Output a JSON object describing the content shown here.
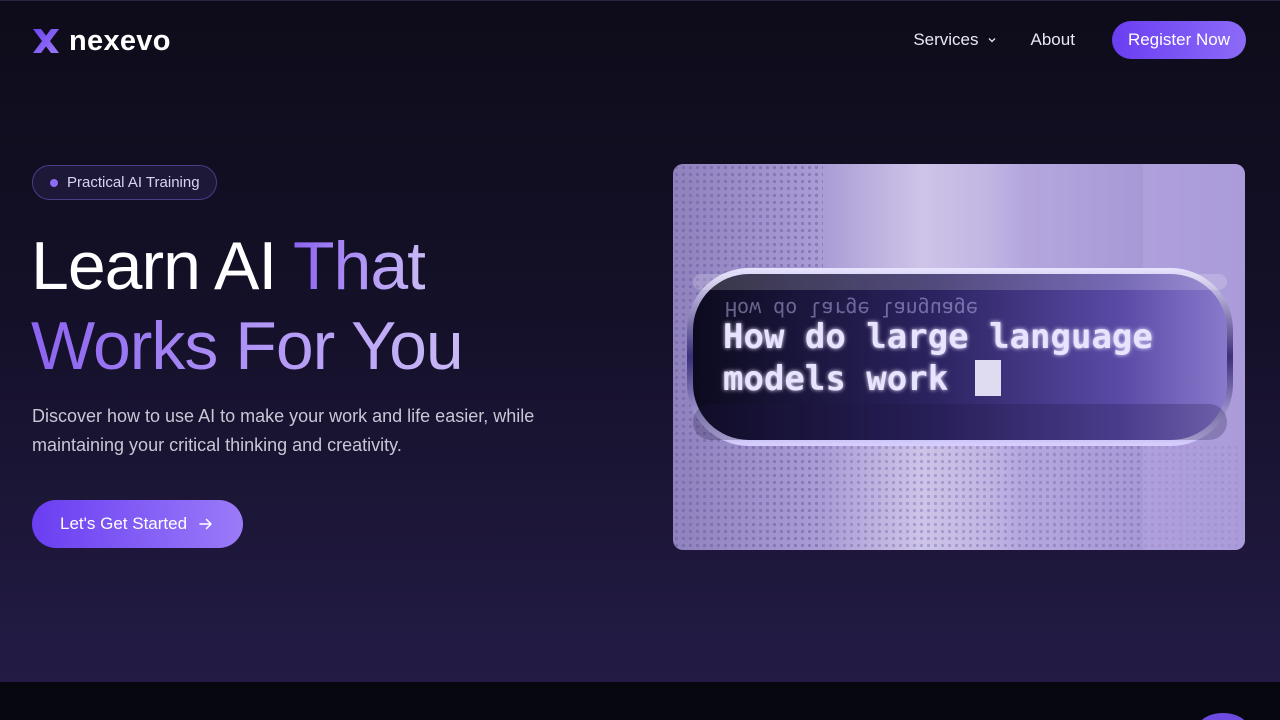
{
  "brand": {
    "name": "nexevo",
    "accent": "#7a4ff0"
  },
  "nav": {
    "services_label": "Services",
    "about_label": "About",
    "register_label": "Register Now"
  },
  "hero": {
    "badge": "Practical AI Training",
    "headline_line1_white": "Learn AI ",
    "headline_line1_accent": "That",
    "headline_line2_accent": "Works For You",
    "subtitle": "Discover how to use AI to make your work and life easier, while maintaining your critical thinking and creativity.",
    "cta_label": "Let's Get Started",
    "cta_icon": "arrow-right-icon"
  },
  "hero_image": {
    "line1": "How do large language",
    "line2": "models work"
  }
}
